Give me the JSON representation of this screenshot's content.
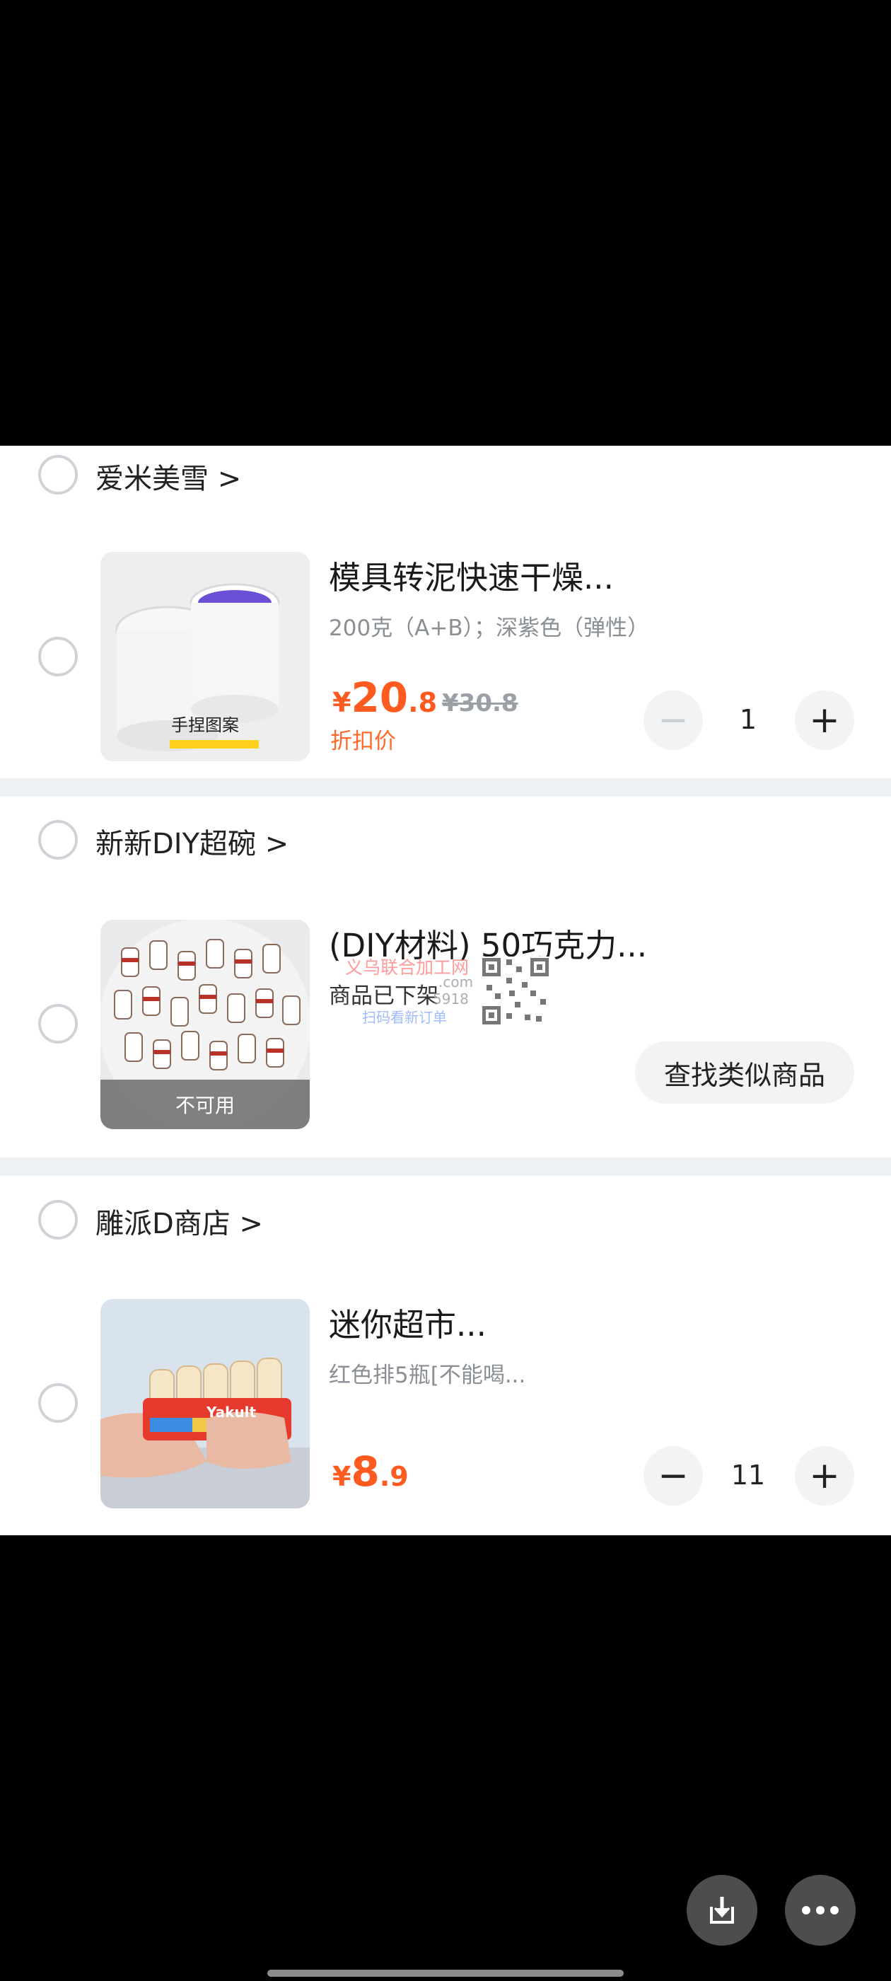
{
  "shops": [
    {
      "name": "爱米美雪 >",
      "item": {
        "title": "模具转泥快速干燥...",
        "variant": "200克（A+B）；深紫色（弹性）",
        "price_currency": "¥",
        "price_int": "20",
        "price_dec": ".8",
        "original_price": "¥30.8",
        "discount_label": "折扣价",
        "quantity": "1",
        "image_caption": "手捏图案"
      }
    },
    {
      "name": "新新DIY超碗 >",
      "item": {
        "title": "(DIY材料) 50巧克力...",
        "status": "商品已下架",
        "image_overlay": "不可用",
        "find_similar": "查找类似商品"
      }
    },
    {
      "name": "雕派D商店 >",
      "item": {
        "title": "迷你超市...",
        "variant": "红色排5瓶[不能喝...",
        "price_currency": "¥",
        "price_int": "8",
        "price_dec": ".9",
        "quantity": "11",
        "image_label": "Yakult"
      }
    }
  ],
  "watermark": {
    "line1": "义乌联合加工网",
    "line2": ".com",
    "line3": "5918",
    "line4": "扫码看新订单"
  },
  "icons": {
    "minus": "−",
    "plus": "+",
    "download": "download-icon",
    "more": "more-icon"
  },
  "colors": {
    "accent": "#ff5a1f",
    "separator": "#eef2f5"
  }
}
